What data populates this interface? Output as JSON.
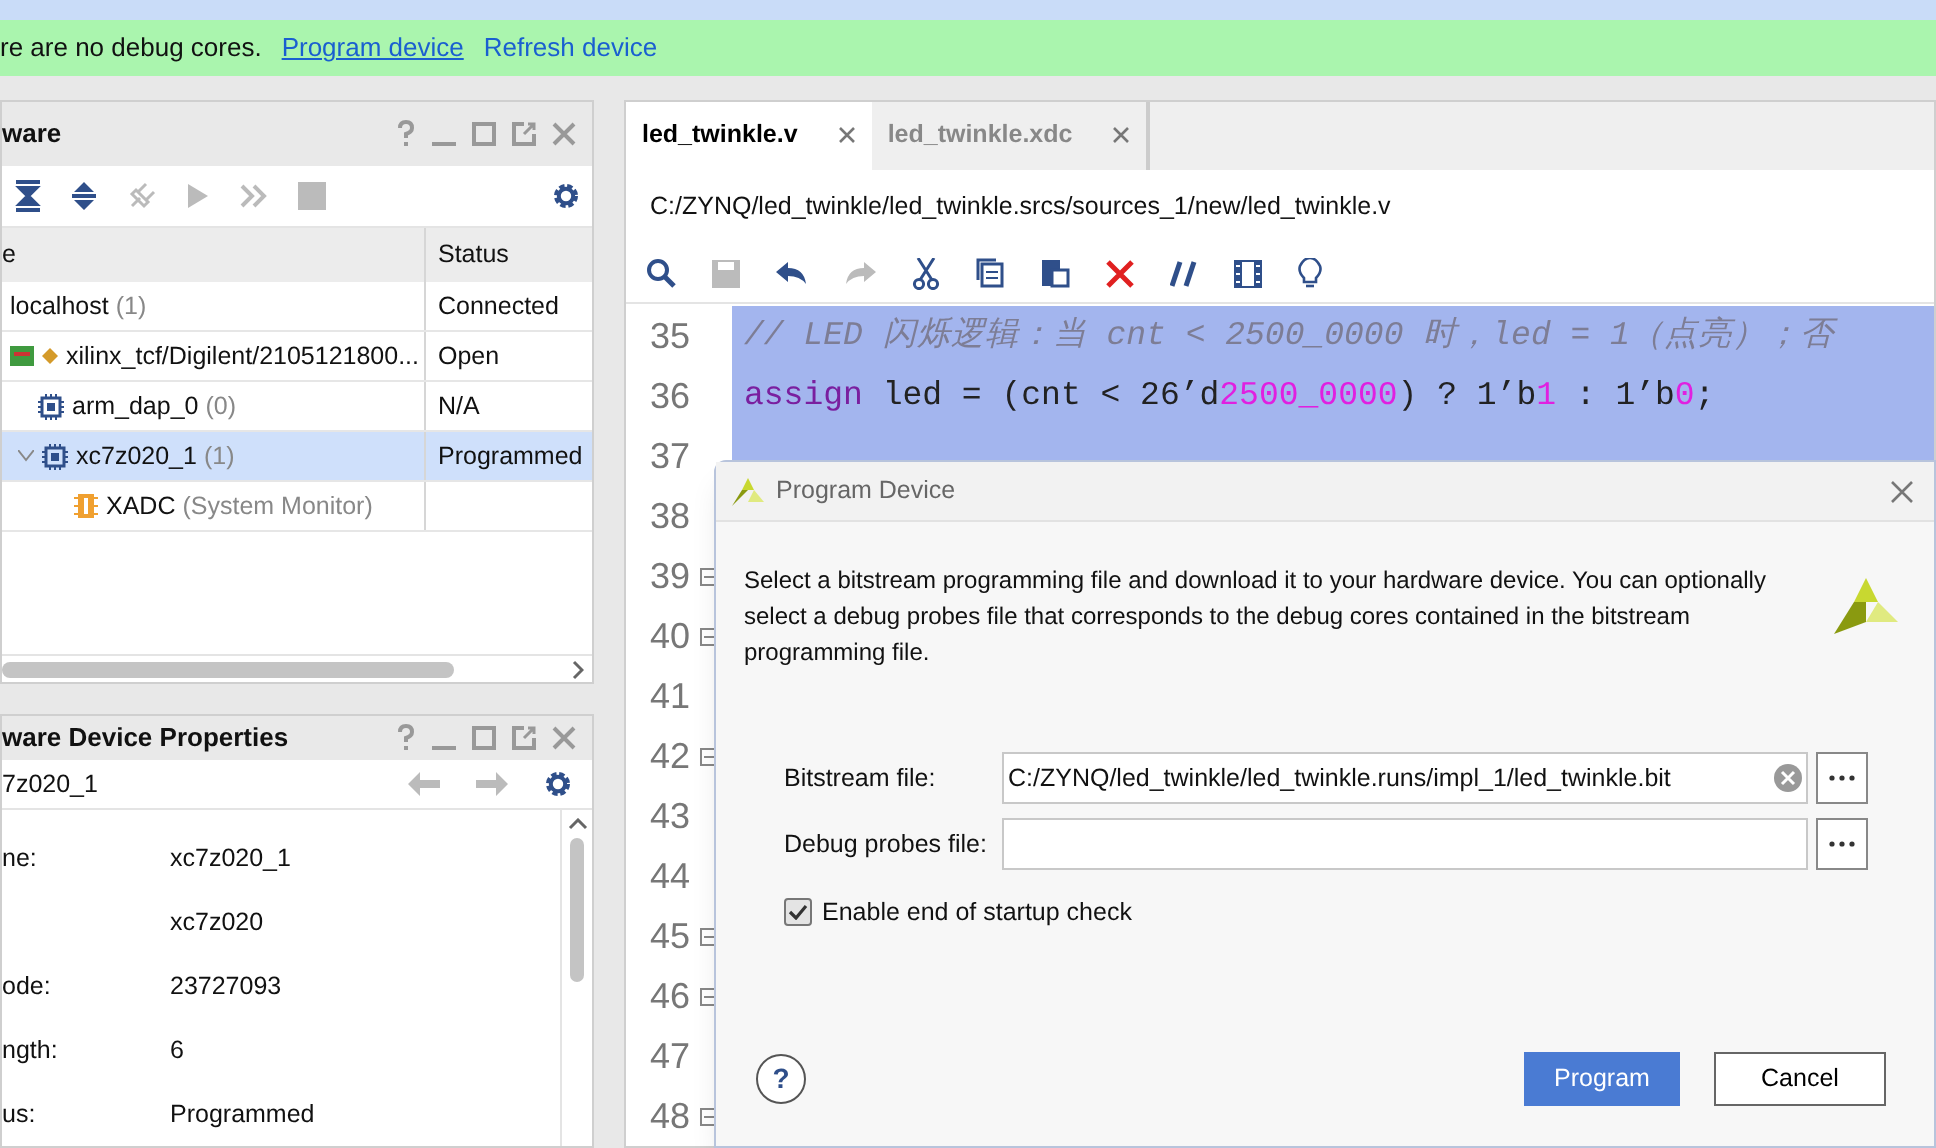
{
  "banner": {
    "message": "re are no debug cores.",
    "links": [
      "Program device",
      "Refresh device"
    ]
  },
  "hardware_panel": {
    "title": "ware",
    "columns": [
      "e",
      "Status"
    ],
    "tree": [
      {
        "name": "localhost",
        "count": "(1)",
        "status": "Connected",
        "selected": false,
        "children": [
          {
            "name": "xilinx_tcf/Digilent/2105121800...",
            "status": "Open",
            "selected": false,
            "children": [
              {
                "name": "arm_dap_0",
                "count": "(0)",
                "status": "N/A",
                "selected": false
              },
              {
                "name": "xc7z020_1",
                "count": "(1)",
                "status": "Programmed",
                "selected": true,
                "expanded": true,
                "children": [
                  {
                    "name": "XADC",
                    "count": "(System Monitor)",
                    "selected": false
                  }
                ]
              }
            ]
          }
        ]
      }
    ]
  },
  "properties_panel": {
    "title": "ware Device Properties",
    "object": "7z020_1",
    "rows": [
      {
        "label": "ne:",
        "value": "xc7z020_1"
      },
      {
        "value": "xc7z020"
      },
      {
        "label": "ode:",
        "value": "23727093"
      },
      {
        "label": "ngth:",
        "value": "6"
      },
      {
        "label": "us:",
        "value": "Programmed"
      }
    ]
  },
  "editor": {
    "tabs": [
      {
        "label": "led_twinkle.v",
        "selected": true
      },
      {
        "label": "led_twinkle.xdc",
        "selected": false
      }
    ],
    "path": "C:/ZYNQ/led_twinkle/led_twinkle.srcs/sources_1/new/led_twinkle.v",
    "lines": [
      {
        "number": "35",
        "highlighted": true,
        "fold": false,
        "tokens": [
          {
            "kind": "comment",
            "text": "// LED 闪烁逻辑：当 cnt < 2500_0000 时，led = 1（点亮）；否"
          }
        ]
      },
      {
        "number": "36",
        "highlighted": true,
        "fold": false,
        "tokens": [
          {
            "kind": "keyword",
            "text": "assign"
          },
          {
            "kind": "plain",
            "text": " led = (cnt < 26’d"
          },
          {
            "kind": "number",
            "text": "2500_0000"
          },
          {
            "kind": "plain",
            "text": ") ? 1’b"
          },
          {
            "kind": "number",
            "text": "1"
          },
          {
            "kind": "plain",
            "text": " : 1’b"
          },
          {
            "kind": "number",
            "text": "0"
          },
          {
            "kind": "plain",
            "text": ";"
          }
        ]
      },
      {
        "number": "37",
        "highlighted": true,
        "fold": false
      },
      {
        "number": "38",
        "fold": false
      },
      {
        "number": "39",
        "fold": true
      },
      {
        "number": "40",
        "fold": true
      },
      {
        "number": "41",
        "fold": false
      },
      {
        "number": "42",
        "fold": true
      },
      {
        "number": "43",
        "fold": false
      },
      {
        "number": "44",
        "fold": false
      },
      {
        "number": "45",
        "fold": true
      },
      {
        "number": "46",
        "fold": true
      },
      {
        "number": "47",
        "fold": false
      },
      {
        "number": "48",
        "fold": true
      }
    ]
  },
  "dialog": {
    "title": "Program Device",
    "description": "Select a bitstream programming file and download it to your hardware device. You can optionally select a debug probes file that corresponds to the debug cores contained in the bitstream programming file.",
    "fields": [
      {
        "label": "Bitstream file:",
        "value": "C:/ZYNQ/led_twinkle/led_twinkle.runs/impl_1/led_twinkle.bit",
        "clearable": true
      },
      {
        "label": "Debug probes file:",
        "clearable": false
      }
    ],
    "checkbox": {
      "label": "Enable end of startup check",
      "checked": true
    },
    "help": "?",
    "buttons": [
      {
        "label": "Program",
        "kind": "primary"
      },
      {
        "label": "Cancel",
        "kind": "secondary"
      }
    ]
  }
}
